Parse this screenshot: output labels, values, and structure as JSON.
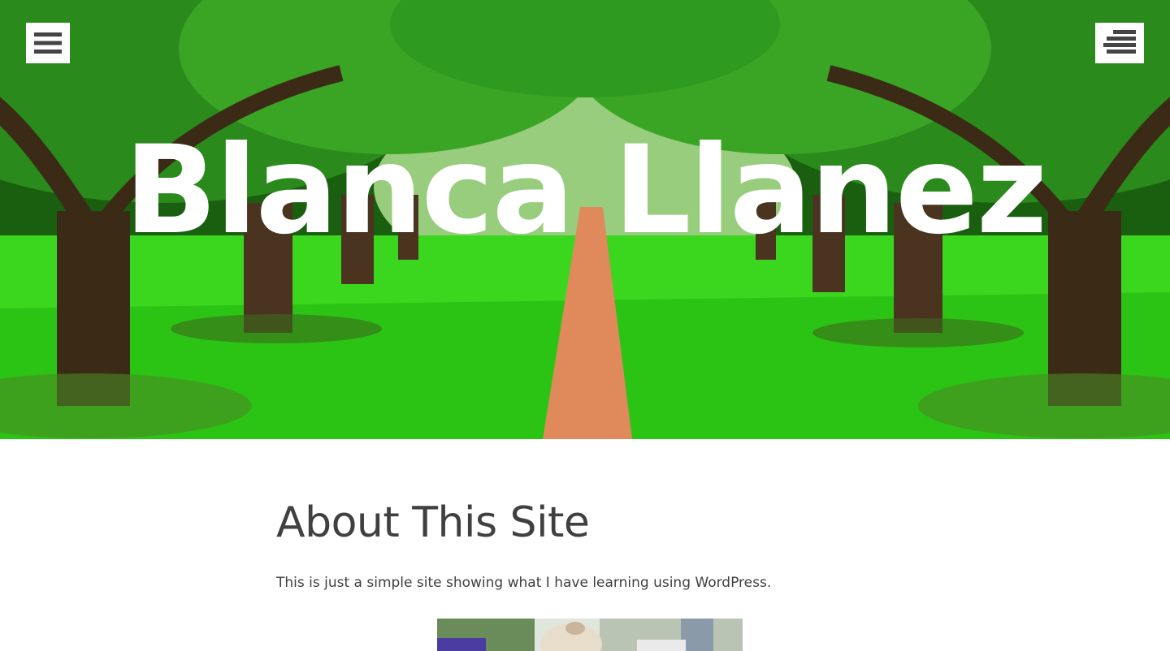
{
  "header": {
    "site_title": "Blanca Llanez",
    "left_menu_icon": "hamburger-menu-icon",
    "right_menu_icon": "sidebar-menu-icon"
  },
  "main": {
    "page_title": "About This Site",
    "page_text": "This is just a simple site showing what I have learning using WordPress."
  },
  "colors": {
    "text": "#404040",
    "button_background": "#ffffff",
    "icon": "#444444"
  }
}
